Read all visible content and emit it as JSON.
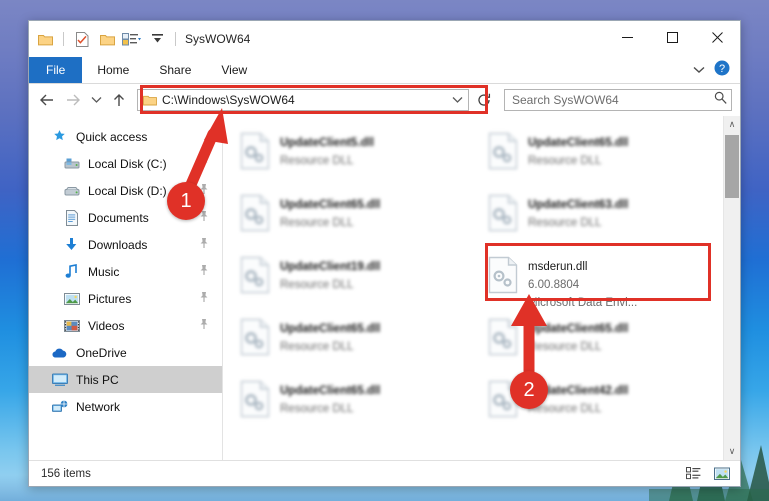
{
  "window": {
    "title": "SysWOW64",
    "quick_access_toolbar": [
      {
        "name": "folder-icon",
        "label": "Folder"
      },
      {
        "name": "properties-icon",
        "label": "Properties"
      },
      {
        "name": "new-folder-icon",
        "label": "New folder"
      },
      {
        "name": "customize-toolbar-icon",
        "label": "Customize Quick Access Toolbar"
      },
      {
        "name": "minimize-ribbon-icon",
        "label": "Minimize the Ribbon"
      }
    ],
    "controls": {
      "minimize": "–",
      "maximize": "□",
      "close": "✕"
    }
  },
  "ribbon": {
    "tabs": [
      {
        "label": "File",
        "active": true
      },
      {
        "label": "Home",
        "active": false
      },
      {
        "label": "Share",
        "active": false
      },
      {
        "label": "View",
        "active": false
      }
    ],
    "expand_label": "∨",
    "help_label": "?"
  },
  "navbar": {
    "back": "←",
    "forward": "→",
    "recent": "∨",
    "up": "↑",
    "address_value": "C:\\Windows\\SysWOW64",
    "address_caret": "∨",
    "refresh_label": "↻"
  },
  "search": {
    "placeholder": "Search SysWOW64"
  },
  "sidebar": {
    "items": [
      {
        "label": "Quick access",
        "icon": "star-pin-icon",
        "pinned": false,
        "indent": false,
        "selected": false
      },
      {
        "label": "Local Disk (C:)",
        "icon": "local-disk-icon",
        "pinned": true,
        "indent": true,
        "selected": false
      },
      {
        "label": "Local Disk (D:)",
        "icon": "local-disk-icon",
        "pinned": true,
        "indent": true,
        "selected": false
      },
      {
        "label": "Documents",
        "icon": "documents-icon",
        "pinned": true,
        "indent": true,
        "selected": false
      },
      {
        "label": "Downloads",
        "icon": "downloads-icon",
        "pinned": true,
        "indent": true,
        "selected": false
      },
      {
        "label": "Music",
        "icon": "music-icon",
        "pinned": true,
        "indent": true,
        "selected": false
      },
      {
        "label": "Pictures",
        "icon": "pictures-icon",
        "pinned": true,
        "indent": true,
        "selected": false
      },
      {
        "label": "Videos",
        "icon": "videos-icon",
        "pinned": true,
        "indent": true,
        "selected": false
      },
      {
        "label": "OneDrive",
        "icon": "onedrive-icon",
        "pinned": false,
        "indent": false,
        "selected": false
      },
      {
        "label": "This PC",
        "icon": "this-pc-icon",
        "pinned": false,
        "indent": false,
        "selected": true
      },
      {
        "label": "Network",
        "icon": "network-icon",
        "pinned": false,
        "indent": false,
        "selected": false
      }
    ]
  },
  "files": [
    {
      "name": "UpdateClient5.dll",
      "line2": "Resource DLL",
      "line3": "",
      "icon": "dll-file-icon",
      "highlighted": false
    },
    {
      "name": "UpdateClient65.dll",
      "line2": "Resource DLL",
      "line3": "",
      "icon": "dll-file-icon",
      "highlighted": false
    },
    {
      "name": "UpdateClient65.dll",
      "line2": "Resource DLL",
      "line3": "",
      "icon": "dll-file-icon",
      "highlighted": false
    },
    {
      "name": "UpdateClient63.dll",
      "line2": "Resource DLL",
      "line3": "",
      "icon": "dll-file-icon",
      "highlighted": false
    },
    {
      "name": "UpdateClient19.dll",
      "line2": "Resource DLL",
      "line3": "",
      "icon": "dll-file-icon",
      "highlighted": false
    },
    {
      "name": "msderun.dll",
      "line2": "6.00.8804",
      "line3": "Microsoft Data Envi...",
      "icon": "dll-file-icon",
      "highlighted": true
    },
    {
      "name": "UpdateClient65.dll",
      "line2": "Resource DLL",
      "line3": "",
      "icon": "dll-file-icon",
      "highlighted": false
    },
    {
      "name": "UpdateClient65.dll",
      "line2": "Resource DLL",
      "line3": "",
      "icon": "dll-file-icon",
      "highlighted": false
    },
    {
      "name": "UpdateClient65.dll",
      "line2": "Resource DLL",
      "line3": "",
      "icon": "dll-file-icon",
      "highlighted": false
    },
    {
      "name": "UpdateClient42.dll",
      "line2": "Resource DLL",
      "line3": "",
      "icon": "dll-file-icon",
      "highlighted": false
    }
  ],
  "scrollbar": {
    "up_arrow": "∧",
    "down_arrow": "∨"
  },
  "statusbar": {
    "item_count": "156 items",
    "details_view_label": "Details view",
    "large_icons_view_label": "Large icons view"
  },
  "annotations": {
    "colors": {
      "marker": "#e03127"
    },
    "markers": [
      {
        "number": "1"
      },
      {
        "number": "2"
      }
    ]
  }
}
